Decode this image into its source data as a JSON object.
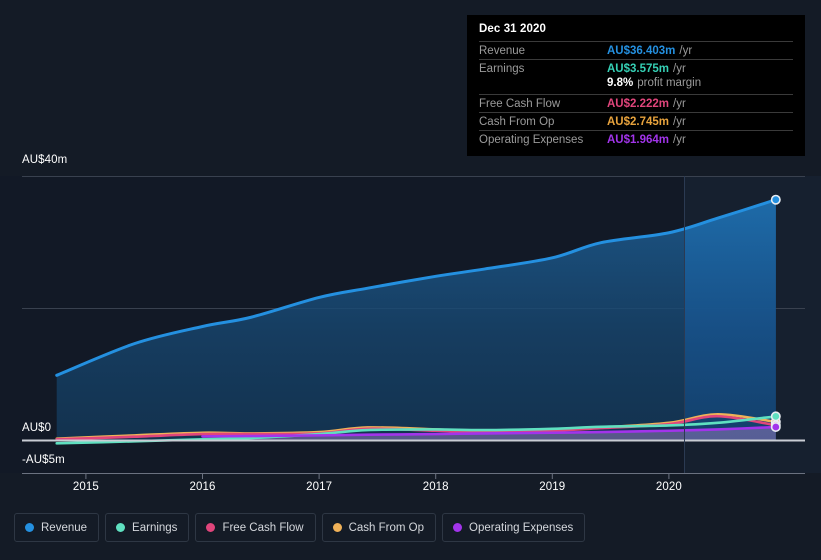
{
  "tooltip": {
    "title": "Dec 31 2020",
    "rows": [
      {
        "label": "Revenue",
        "value": "AU$36.403m",
        "unit": "/yr",
        "color": "#2490e0"
      },
      {
        "label": "Earnings",
        "value": "AU$3.575m",
        "unit": "/yr",
        "color": "#35d0b5"
      },
      {
        "label": "Free Cash Flow",
        "value": "AU$2.222m",
        "unit": "/yr",
        "color": "#e0457b"
      },
      {
        "label": "Cash From Op",
        "value": "AU$2.745m",
        "unit": "/yr",
        "color": "#e8a33d"
      },
      {
        "label": "Operating Expenses",
        "value": "AU$1.964m",
        "unit": "/yr",
        "color": "#a234eb"
      }
    ],
    "margin_value": "9.8%",
    "margin_text": "profit margin"
  },
  "legend": {
    "items": [
      {
        "label": "Revenue",
        "color": "#2490e0"
      },
      {
        "label": "Earnings",
        "color": "#5fe0c0"
      },
      {
        "label": "Free Cash Flow",
        "color": "#e0457b"
      },
      {
        "label": "Cash From Op",
        "color": "#efb158"
      },
      {
        "label": "Operating Expenses",
        "color": "#a234eb"
      }
    ]
  },
  "chart_data": {
    "type": "area",
    "title": "",
    "xlabel": "",
    "ylabel": "",
    "currency": "AU$",
    "ylim": [
      -5,
      45
    ],
    "y_ticks": [
      {
        "value": 40,
        "label": "AU$40m"
      },
      {
        "value": 0,
        "label": "AU$0"
      },
      {
        "value": -5,
        "label": "-AU$5m"
      }
    ],
    "x_ticks": [
      "2015",
      "2016",
      "2017",
      "2018",
      "2019",
      "2020"
    ],
    "x_range": [
      "2014-09",
      "2021-03"
    ],
    "grid": true,
    "legend_position": "bottom-left",
    "forecast_divider": "2020",
    "series": [
      {
        "name": "Revenue",
        "color": "#2490e0",
        "filled": true,
        "x": [
          "2014-10",
          "2015-06",
          "2016-01",
          "2016-06",
          "2017-01",
          "2017-06",
          "2018-01",
          "2018-06",
          "2019-01",
          "2019-06",
          "2020-01",
          "2020-06",
          "2020-12"
        ],
        "values": [
          9.8,
          14.6,
          17.2,
          18.6,
          21.6,
          23.0,
          24.8,
          25.9,
          27.6,
          29.9,
          31.4,
          33.6,
          36.403
        ]
      },
      {
        "name": "Earnings",
        "color": "#5fe0c0",
        "filled": false,
        "x": [
          "2014-10",
          "2015-06",
          "2016-01",
          "2016-06",
          "2017-01",
          "2017-06",
          "2018-01",
          "2018-06",
          "2019-01",
          "2019-06",
          "2020-01",
          "2020-06",
          "2020-12"
        ],
        "values": [
          -0.5,
          -0.2,
          0.1,
          0.3,
          0.9,
          1.5,
          1.6,
          1.5,
          1.7,
          2.0,
          2.2,
          2.6,
          3.575
        ]
      },
      {
        "name": "Free Cash Flow",
        "color": "#e0457b",
        "filled": false,
        "x": [
          "2014-10",
          "2015-06",
          "2016-01",
          "2016-06",
          "2017-01",
          "2017-06",
          "2018-01",
          "2018-06",
          "2019-01",
          "2019-06",
          "2020-01",
          "2020-06",
          "2020-12"
        ],
        "values": [
          0.1,
          0.5,
          0.9,
          0.9,
          1.0,
          1.7,
          1.4,
          1.2,
          1.4,
          1.8,
          2.4,
          3.6,
          2.222
        ]
      },
      {
        "name": "Cash From Op",
        "color": "#efb158",
        "filled": false,
        "x": [
          "2014-10",
          "2015-06",
          "2016-01",
          "2016-06",
          "2017-01",
          "2017-06",
          "2018-01",
          "2018-06",
          "2019-01",
          "2019-06",
          "2020-01",
          "2020-06",
          "2020-12"
        ],
        "values": [
          0.2,
          0.7,
          1.1,
          1.0,
          1.2,
          1.9,
          1.6,
          1.3,
          1.5,
          1.9,
          2.6,
          3.9,
          2.745
        ]
      },
      {
        "name": "Operating Expenses",
        "color": "#a234eb",
        "filled": false,
        "x": [
          "2016-01",
          "2016-06",
          "2017-01",
          "2017-06",
          "2018-01",
          "2018-06",
          "2019-01",
          "2019-06",
          "2020-01",
          "2020-06",
          "2020-12"
        ],
        "values": [
          0.55,
          0.6,
          0.7,
          0.8,
          0.9,
          1.0,
          1.1,
          1.2,
          1.4,
          1.6,
          1.964
        ]
      }
    ],
    "end_markers": [
      {
        "name": "Revenue",
        "color": "#2490e0"
      },
      {
        "name": "Earnings",
        "color": "#5fe0c0"
      },
      {
        "name": "Free Cash Flow",
        "color": "#e0457b"
      },
      {
        "name": "Cash From Op",
        "color": "#efb158"
      },
      {
        "name": "Operating Expenses",
        "color": "#a234eb"
      }
    ]
  }
}
